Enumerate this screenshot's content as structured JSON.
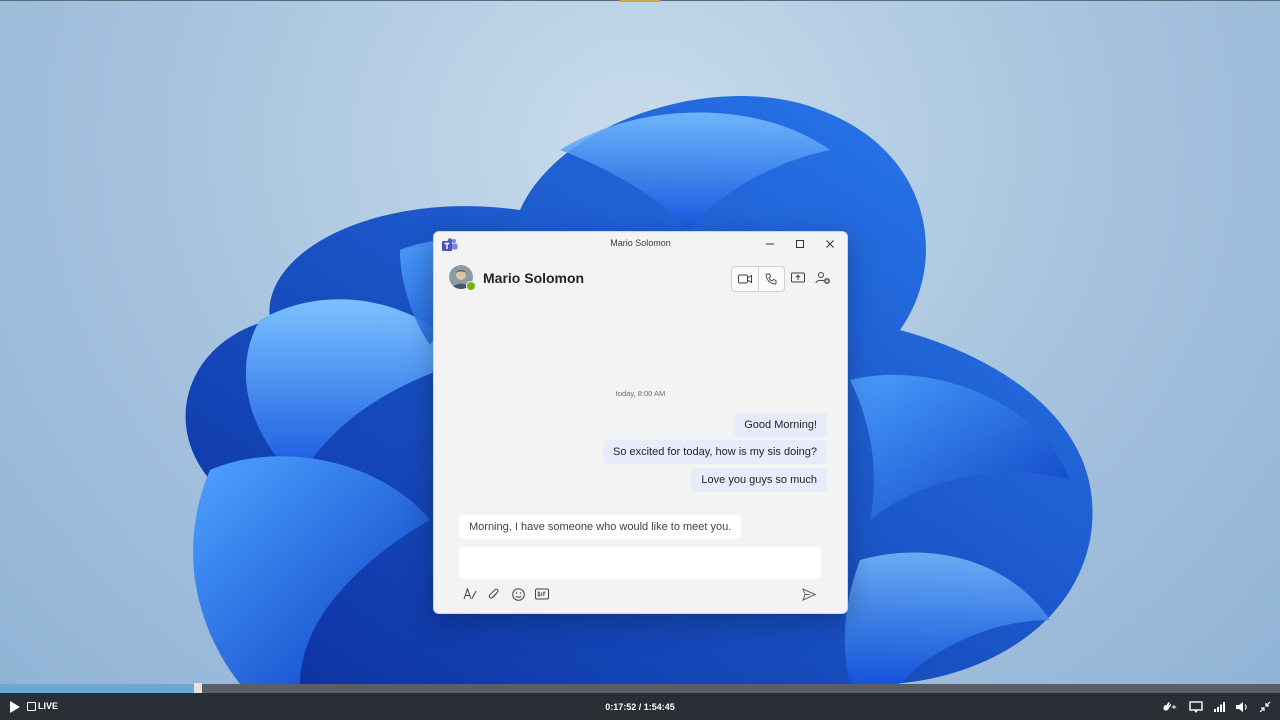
{
  "window": {
    "title": "Mario Solomon",
    "app_icon": "teams-icon"
  },
  "chat": {
    "contact_name": "Mario Solomon",
    "presence": "available",
    "timestamp": "today, 8:00 AM",
    "messages_out": [
      {
        "text": "Good Morning!"
      },
      {
        "text": "So excited for today, how is my sis doing?"
      },
      {
        "text": "Love you guys so much"
      }
    ],
    "messages_in": [
      {
        "text": "Morning, I have someone who would like to meet you."
      }
    ],
    "compose_value": ""
  },
  "header_icons": [
    "video-call-icon",
    "audio-call-icon",
    "share-screen-icon",
    "add-people-icon"
  ],
  "toolbar_icons": [
    "format-icon",
    "attach-icon",
    "emoji-icon",
    "gif-icon",
    "send-icon"
  ],
  "player": {
    "live_label": "LIVE",
    "time": "0:17:52 / 1:54:45",
    "progress": 0.155
  },
  "colors": {
    "presence_green": "#6bb700",
    "out_bubble": "#e8ebfa",
    "teams_purple": "#5b5fc7",
    "progress_fill": "#6ea7d0"
  }
}
